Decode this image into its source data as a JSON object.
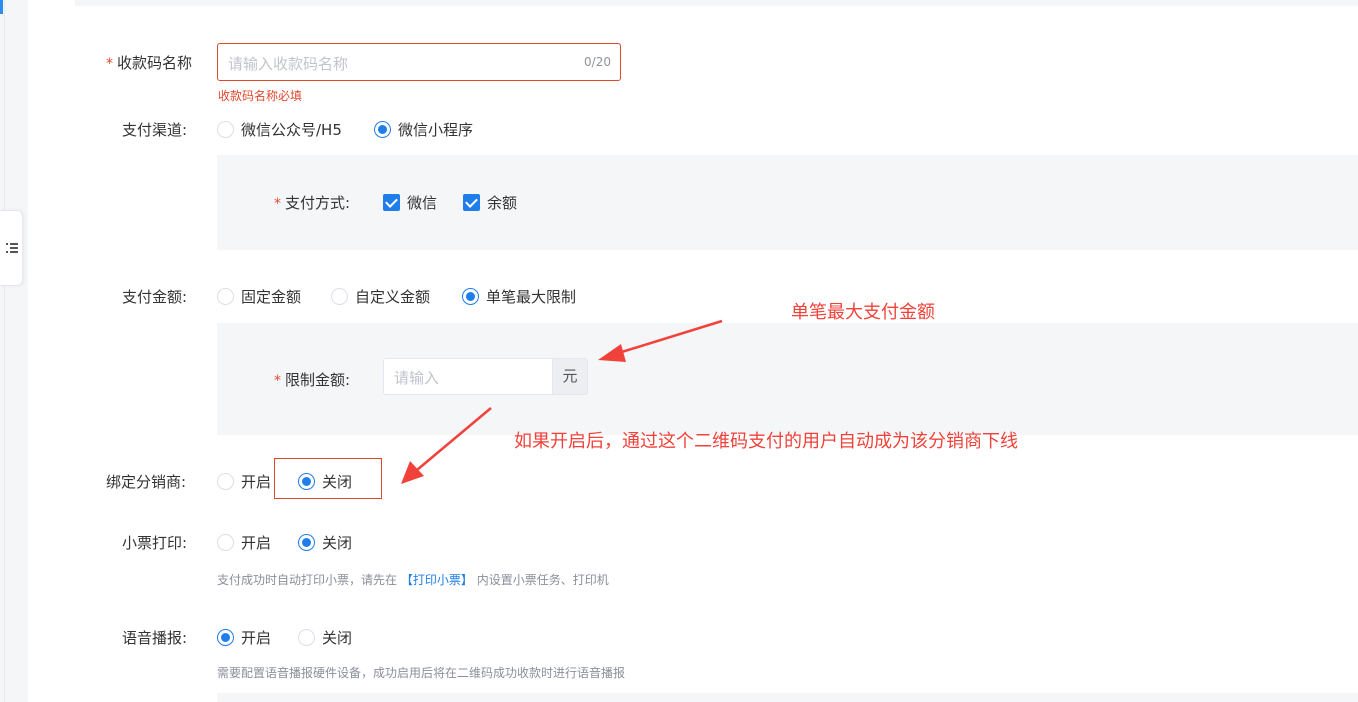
{
  "form": {
    "name_field": {
      "required_mark": "*",
      "label": "收款码名称",
      "placeholder": "请输入收款码名称",
      "counter": "0/20",
      "error": "收款码名称必填"
    },
    "channel": {
      "label": "支付渠道:",
      "options": [
        "微信公众号/H5",
        "微信小程序"
      ],
      "selected": "微信小程序"
    },
    "pay_method": {
      "required_mark": "*",
      "label": "支付方式:",
      "options": [
        "微信",
        "余额"
      ],
      "checked": [
        "微信",
        "余额"
      ]
    },
    "amount": {
      "label": "支付金额:",
      "options": [
        "固定金额",
        "自定义金额",
        "单笔最大限制"
      ],
      "selected": "单笔最大限制"
    },
    "limit_amount": {
      "required_mark": "*",
      "label": "限制金额:",
      "placeholder": "请输入",
      "suffix": "元"
    },
    "bind_distributor": {
      "label": "绑定分销商:",
      "options": [
        "开启",
        "关闭"
      ],
      "selected": "关闭"
    },
    "receipt_print": {
      "label": "小票打印:",
      "options": [
        "开启",
        "关闭"
      ],
      "selected": "关闭",
      "hint_prefix": "支付成功时自动打印小票，请先在",
      "hint_link": "【打印小票】",
      "hint_suffix": "内设置小票任务、打印机"
    },
    "voice": {
      "label": "语音播报:",
      "options": [
        "开启",
        "关闭"
      ],
      "selected": "开启",
      "hint": "需要配置语音播报硬件设备，成功启用后将在二维码成功收款时进行语音播报"
    }
  },
  "annotations": {
    "max_amount_note": "单笔最大支付金额",
    "distributor_note": "如果开启后，通过这个二维码支付的用户自动成为该分销商下线",
    "color": "#f0423a"
  },
  "colors": {
    "primary": "#1f7eea",
    "error": "#e0482e",
    "panel": "#f5f6f8"
  },
  "icons": {
    "sidebar_toggle": "list-collapse-icon"
  }
}
